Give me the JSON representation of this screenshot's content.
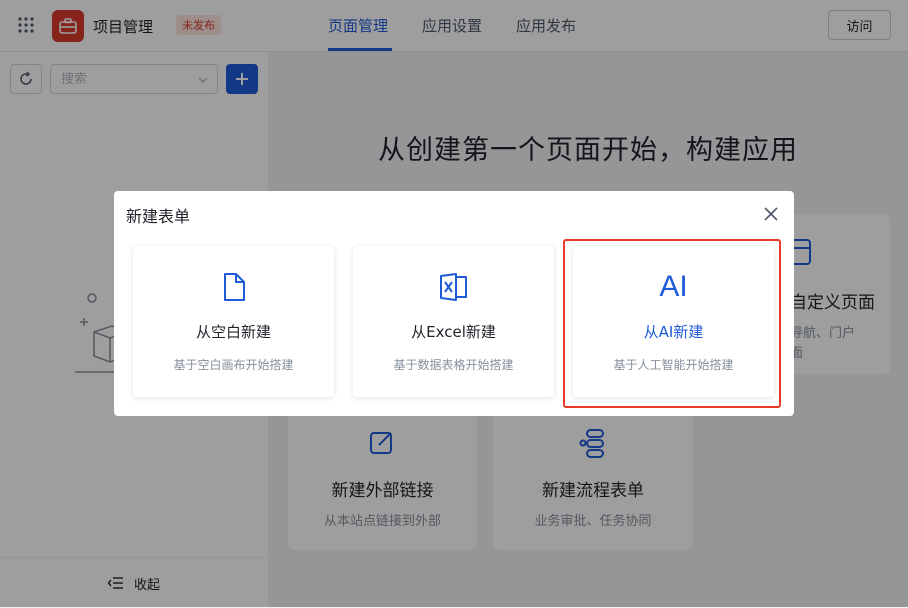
{
  "header": {
    "app_name": "项目管理",
    "status_badge": "未发布",
    "tabs": [
      {
        "label": "页面管理",
        "active": true
      },
      {
        "label": "应用设置",
        "active": false
      },
      {
        "label": "应用发布",
        "active": false
      }
    ],
    "visit_label": "访问"
  },
  "sidebar": {
    "search_placeholder": "搜索",
    "collapse_label": "收起"
  },
  "main": {
    "title": "从创建第一个页面开始，构建应用",
    "cards": [
      {
        "title": "新建外部链接",
        "desc": "从本站点链接到外部"
      },
      {
        "title": "新建流程表单",
        "desc": "业务审批、任务协同"
      },
      {
        "title": "自定义页面",
        "desc": "导航、门户",
        "desc2": "面"
      }
    ]
  },
  "dialog": {
    "title": "新建表单",
    "options": [
      {
        "label": "从空白新建",
        "desc": "基于空白画布开始搭建",
        "icon": "blank-document-icon"
      },
      {
        "label": "从Excel新建",
        "desc": "基于数据表格开始搭建",
        "icon": "excel-icon"
      },
      {
        "label": "从AI新建",
        "desc": "基于人工智能开始搭建",
        "icon": "ai-icon",
        "icon_text": "AI"
      }
    ]
  },
  "colors": {
    "accent": "#1f5bd9",
    "logo": "#d9392b",
    "highlight": "#e8392b"
  }
}
